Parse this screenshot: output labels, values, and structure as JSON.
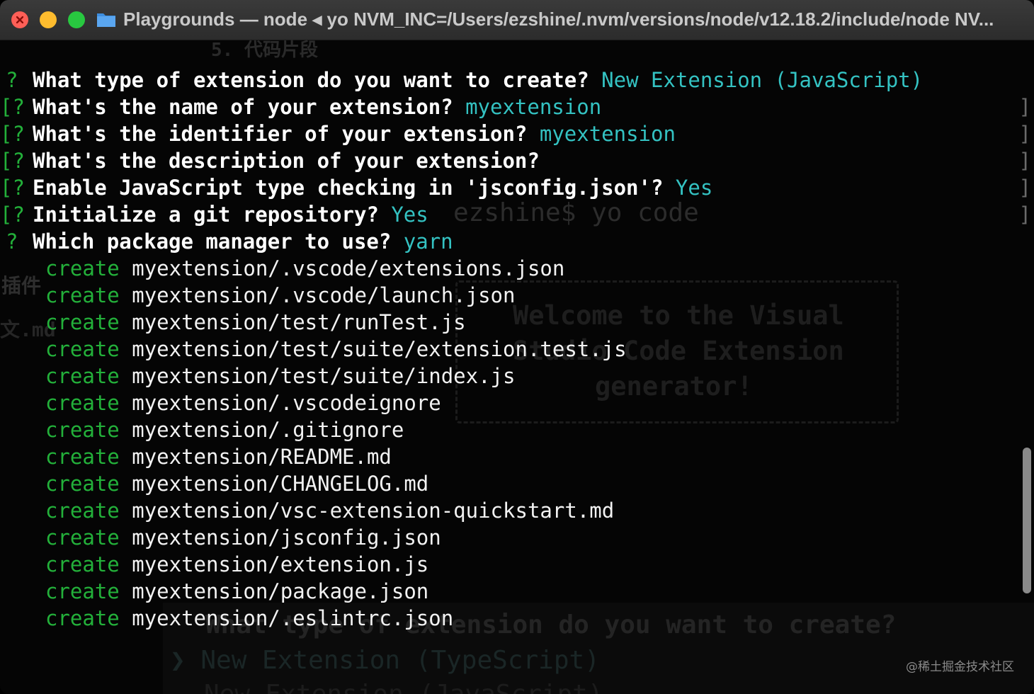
{
  "window": {
    "title": "Playgrounds — node ◂ yo NVM_INC=/Users/ezshine/.nvm/versions/node/v12.18.2/include/node NV..."
  },
  "prompts": [
    {
      "prefix": "?",
      "question": "What type of extension do you want to create?",
      "answer": "New Extension (JavaScript)"
    },
    {
      "prefix": "[?",
      "question": "What's the name of your extension?",
      "answer": "myextension"
    },
    {
      "prefix": "[?",
      "question": "What's the identifier of your extension?",
      "answer": "myextension"
    },
    {
      "prefix": "[?",
      "question": "What's the description of your extension?",
      "answer": ""
    },
    {
      "prefix": "[?",
      "question": "Enable JavaScript type checking in 'jsconfig.json'?",
      "answer": "Yes"
    },
    {
      "prefix": "[?",
      "question": "Initialize a git repository?",
      "answer": "Yes"
    },
    {
      "prefix": "?",
      "question": "Which package manager to use?",
      "answer": "yarn"
    }
  ],
  "create_keyword": "create",
  "created_files": [
    "myextension/.vscode/extensions.json",
    "myextension/.vscode/launch.json",
    "myextension/test/runTest.js",
    "myextension/test/suite/extension.test.js",
    "myextension/test/suite/index.js",
    "myextension/.vscodeignore",
    "myextension/.gitignore",
    "myextension/README.md",
    "myextension/CHANGELOG.md",
    "myextension/vsc-extension-quickstart.md",
    "myextension/jsconfig.json",
    "myextension/extension.js",
    "myextension/package.json",
    "myextension/.eslintrc.json"
  ],
  "ghost": {
    "section": "5. 代码片段",
    "plugin": "插件",
    "md": "文.md",
    "cmd": "ezshine$ yo code",
    "welcome_1": "Welcome to the Visual",
    "welcome_2": "Studio Code Extension",
    "welcome_3": "generator!",
    "bottom_q": "What type of extension do you want to create?",
    "bottom_opt": "❯ New Extension (TypeScript)",
    "bottom_opt2": "New Extension (JavaScript)"
  },
  "watermark": "@稀土掘金技术社区",
  "colors": {
    "prompt_prefix": "#23b03a",
    "answer": "#34c2c2",
    "create": "#23b03a"
  }
}
